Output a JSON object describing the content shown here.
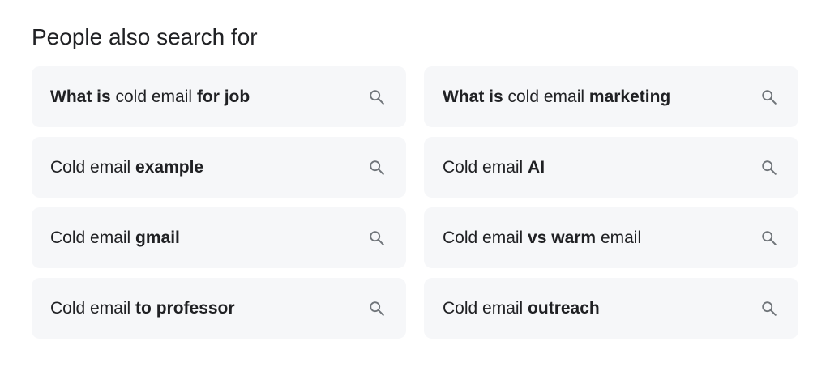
{
  "heading": "People also search for",
  "icon": "search-icon",
  "colors": {
    "chip_background": "#f6f7f9",
    "text": "#202124",
    "icon": "#70757a"
  },
  "suggestions": [
    {
      "parts": [
        {
          "text": "What is",
          "bold": true
        },
        {
          "text": " cold email ",
          "bold": false
        },
        {
          "text": "for job",
          "bold": true
        }
      ]
    },
    {
      "parts": [
        {
          "text": "What is",
          "bold": true
        },
        {
          "text": " cold email ",
          "bold": false
        },
        {
          "text": "marketing",
          "bold": true
        }
      ]
    },
    {
      "parts": [
        {
          "text": "Cold email ",
          "bold": false
        },
        {
          "text": "example",
          "bold": true
        }
      ]
    },
    {
      "parts": [
        {
          "text": "Cold email ",
          "bold": false
        },
        {
          "text": "AI",
          "bold": true
        }
      ]
    },
    {
      "parts": [
        {
          "text": "Cold email ",
          "bold": false
        },
        {
          "text": "gmail",
          "bold": true
        }
      ]
    },
    {
      "parts": [
        {
          "text": "Cold email ",
          "bold": false
        },
        {
          "text": "vs warm",
          "bold": true
        },
        {
          "text": " email",
          "bold": false
        }
      ]
    },
    {
      "parts": [
        {
          "text": "Cold email ",
          "bold": false
        },
        {
          "text": "to professor",
          "bold": true
        }
      ]
    },
    {
      "parts": [
        {
          "text": "Cold email ",
          "bold": false
        },
        {
          "text": "outreach",
          "bold": true
        }
      ]
    }
  ]
}
